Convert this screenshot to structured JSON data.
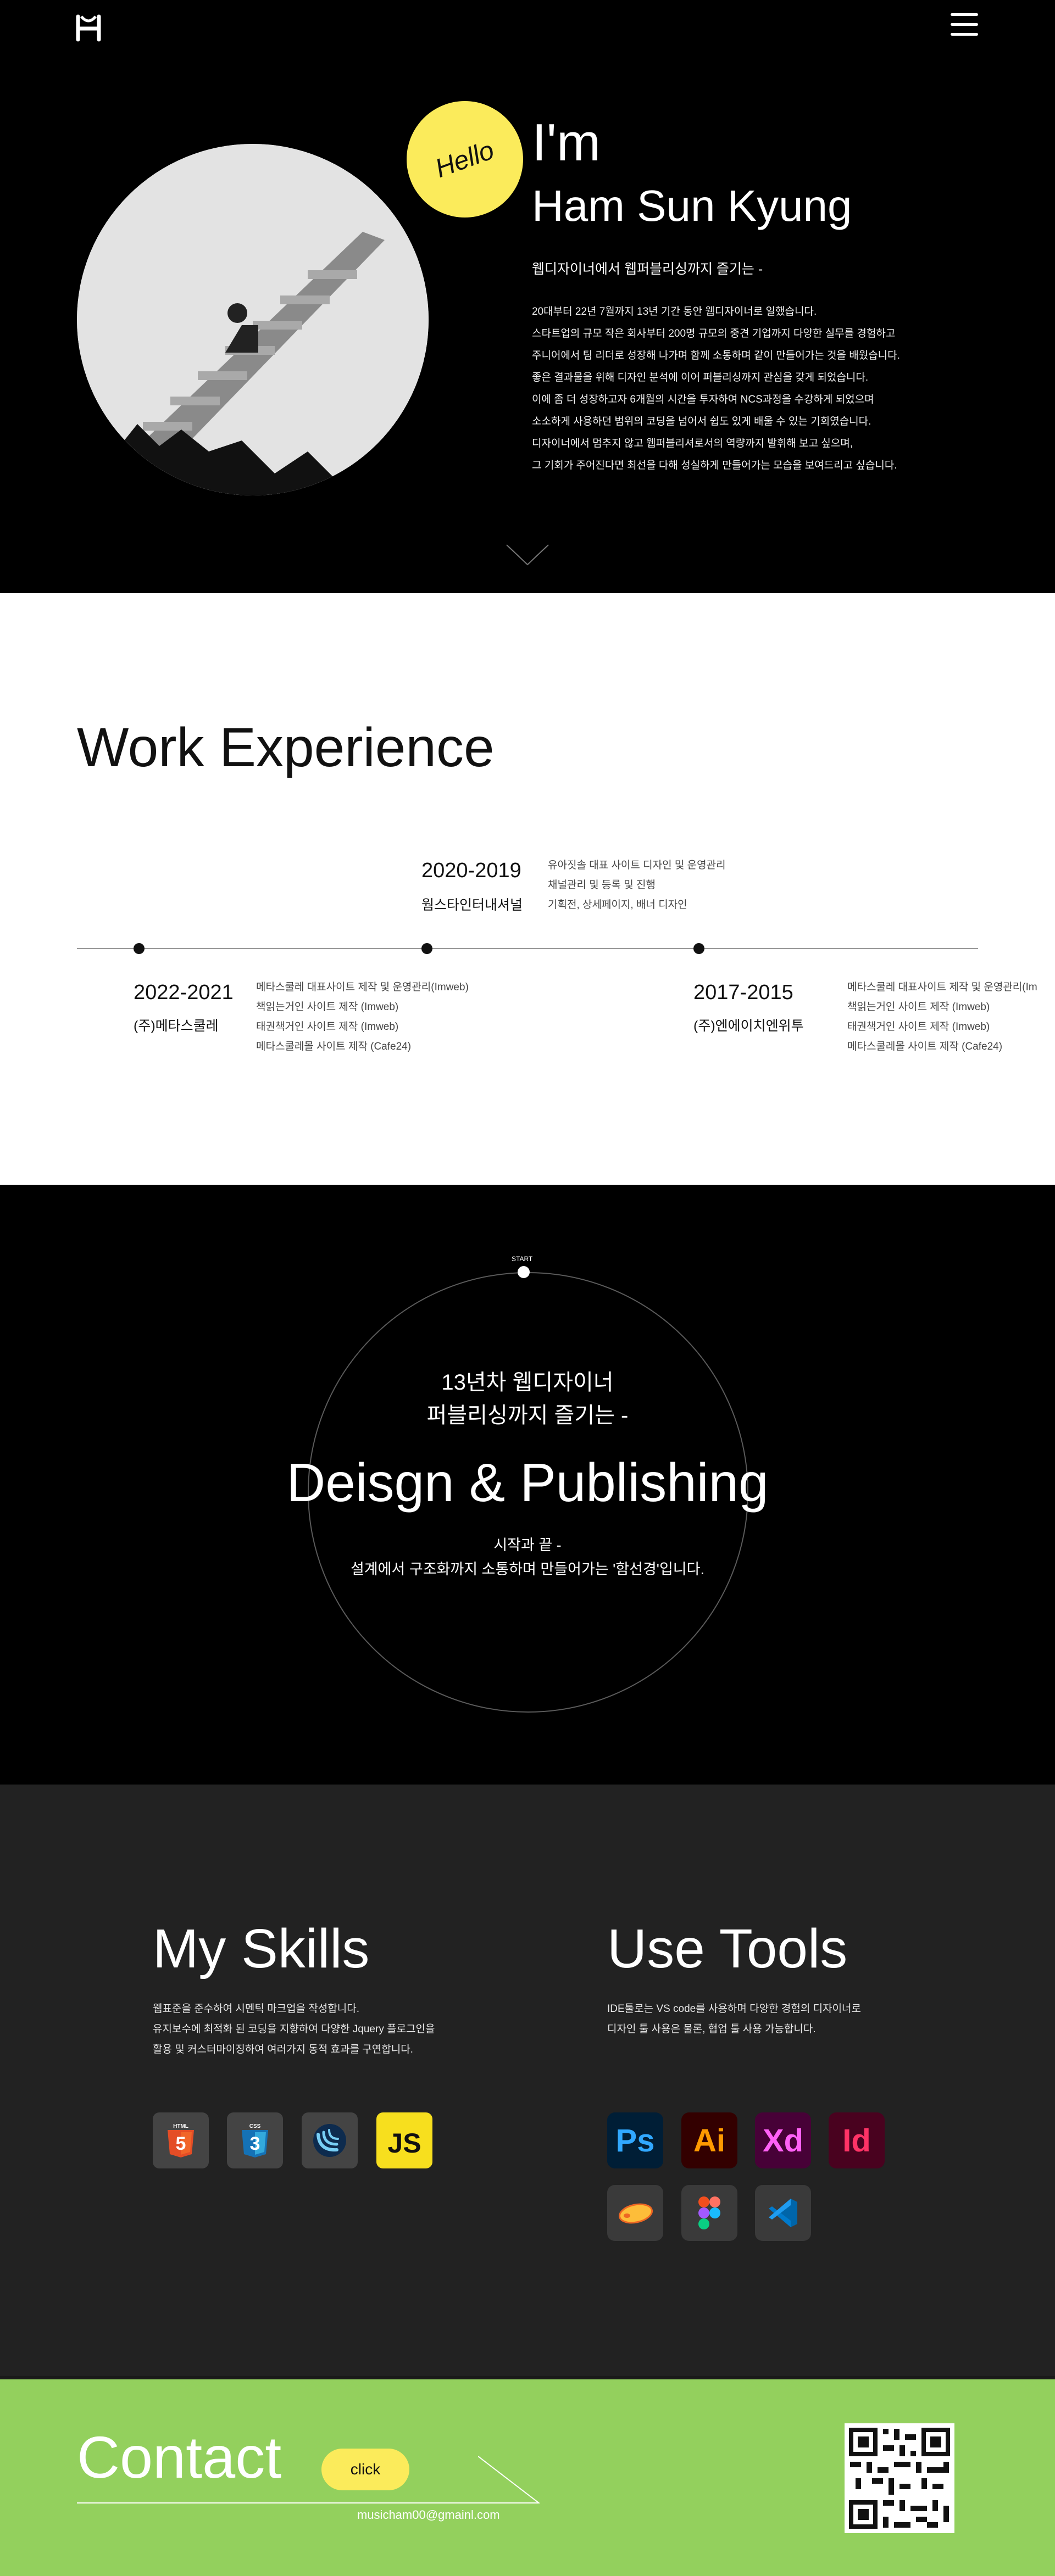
{
  "hero": {
    "hello": "Hello",
    "im": "I'm",
    "name": "Ham Sun Kyung",
    "tagline": "웹디자이너에서 웹퍼블리싱까지 즐기는 -",
    "bio": [
      "20대부터 22년 7월까지 13년 기간 동안 웹디자이너로 일했습니다.",
      "스타트업의 규모 작은 회사부터 200명 규모의 중견 기업까지 다양한 실무를 경험하고",
      "주니어에서 팀 리더로 성장해 나가며 함께 소통하며 같이 만들어가는 것을 배웠습니다.",
      "좋은 결과물을 위해 디자인 분석에 이어 퍼블리싱까지 관심을 갖게 되었습니다.",
      "이에 좀 더 성장하고자 6개월의 시간을 투자하여 NCS과정을 수강하게 되었으며",
      "소소하게 사용하던 범위의 코딩을 넘어서 쉽도 있게 배울 수 있는 기회였습니다.",
      "디자이너에서 멈추지 않고 웹퍼블리셔로서의 역량까지 발휘해 보고 싶으며,",
      "그 기회가 주어진다면 최선을 다해 성실하게 만들어가는 모습을 보여드리고 싶습니다."
    ]
  },
  "work": {
    "title": "Work Experience",
    "items": [
      {
        "period": "2020-2019",
        "company": "웜스타인터내셔널",
        "tasks": [
          "유아짓솔 대표 사이트 디자인 및 운영관리",
          "채널관리 및 등록 및 진행",
          "기획전, 상세페이지, 배너 디자인"
        ]
      },
      {
        "period": "2022-2021",
        "company": "(주)메타스쿨레",
        "tasks": [
          "메타스쿨레 대표사이트 제작 및 운영관리(Imweb)",
          "책읽는거인 사이트 제작 (Imweb)",
          "태권책거인 사이트 제작 (Imweb)",
          "메타스쿨레몰 사이트 제작 (Cafe24)"
        ]
      },
      {
        "period": "2017-2015",
        "company": "(주)엔에이치엔위투",
        "tasks": [
          "메타스쿨레 대표사이트 제작 및 운영관리(Im",
          "책읽는거인 사이트 제작 (Imweb)",
          "태권책거인 사이트 제작 (Imweb)",
          "메타스쿨레몰 사이트 제작 (Cafe24)"
        ]
      }
    ]
  },
  "design": {
    "start_label": "START",
    "intro_line1": "13년차 웹디자이너",
    "intro_line2": "퍼블리싱까지 즐기는 -",
    "big_title": "Deisgn & Publishing",
    "outro_line1": "시작과 끝 -",
    "outro_line2": "설계에서 구조화까지 소통하며 만들어가는 '함선경'입니다."
  },
  "skills": {
    "title": "My Skills",
    "desc": [
      "웹표준을 준수하여 시멘틱 마크업을  작성합니다.",
      "유지보수에 최적화 된 코딩을 지향하여 다양한  Jquery 플로그인을",
      "활용 및 커스터마이징하여 여러가지 동적 효과를 구연합니다."
    ],
    "icons": [
      {
        "name": "html5-icon",
        "label": "HTML",
        "glyph": "5",
        "color": "#e44d26"
      },
      {
        "name": "css3-icon",
        "label": "CSS",
        "glyph": "3",
        "color": "#1572b6"
      },
      {
        "name": "jquery-icon",
        "color": "#0769ad"
      },
      {
        "name": "javascript-icon",
        "glyph": "JS",
        "color": "#f7df1e"
      }
    ]
  },
  "tools": {
    "title": "Use Tools",
    "desc": [
      "IDE툴로는 VS code를 사용하며 다양한 경험의 디자이너로",
      "디자인 툴 사용은 물론, 협업 툴 사용 가능합니다."
    ],
    "icons": [
      {
        "name": "photoshop-icon",
        "glyph": "Ps",
        "bg": "#001e36",
        "fg": "#31a8ff"
      },
      {
        "name": "illustrator-icon",
        "glyph": "Ai",
        "bg": "#330000",
        "fg": "#ff9a00"
      },
      {
        "name": "xd-icon",
        "glyph": "Xd",
        "bg": "#470137",
        "fg": "#ff61f6"
      },
      {
        "name": "indesign-icon",
        "glyph": "Id",
        "bg": "#49021f",
        "fg": "#ff3366"
      },
      {
        "name": "zeplin-icon",
        "bg": "#3a3a3a"
      },
      {
        "name": "figma-icon",
        "bg": "#3a3a3a"
      },
      {
        "name": "vscode-icon",
        "bg": "#3a3a3a"
      }
    ]
  },
  "contact": {
    "title": "Contact",
    "button": "click",
    "email": "musicham00@gmainl.com"
  }
}
